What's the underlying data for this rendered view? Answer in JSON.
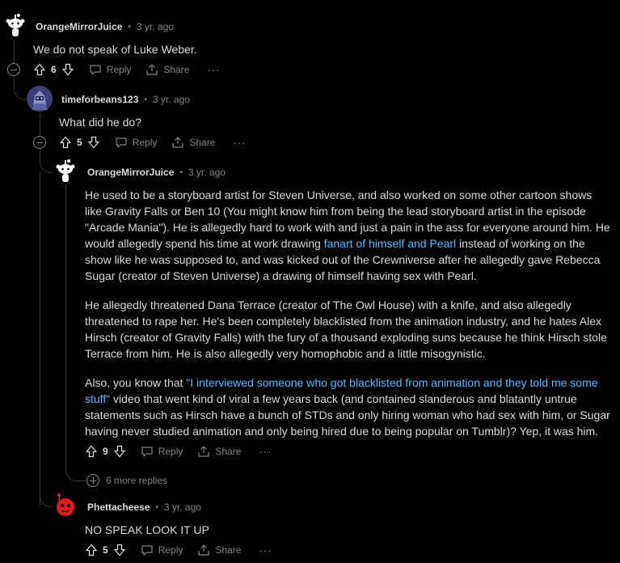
{
  "colors": {
    "background": "#000000",
    "text": "#d7dadc",
    "muted": "#818384",
    "link": "#4fbcff",
    "thread": "#343536"
  },
  "comments": [
    {
      "author": "OrangeMirrorJuice",
      "time": "3 yr. ago",
      "paragraphs": [
        [
          "We do not speak of Luke Weber."
        ]
      ],
      "score": "6",
      "reply_label": "Reply",
      "share_label": "Share",
      "more_label": "···"
    },
    {
      "author": "timeforbeans123",
      "time": "3 yr. ago",
      "paragraphs": [
        [
          "What did he do?"
        ]
      ],
      "score": "5",
      "reply_label": "Reply",
      "share_label": "Share",
      "more_label": "···"
    },
    {
      "author": "OrangeMirrorJuice",
      "time": "3 yr. ago",
      "paragraphs": [
        [
          "He used to be a storyboard artist for Steven Universe, and also worked on some other cartoon shows like Gravity Falls or Ben 10 (You might know him from being the lead storyboard artist in the episode \"Arcade Mania\"). He is allegedly hard to work with and just a pain in the ass for everyone around him. He would allegedly spend his time at work drawing ",
          "fanart of himself and Pearl",
          " instead of working on the show like he was supposed to, and was kicked out of the Crewniverse after he allegedly gave Rebecca Sugar (creator of Steven Universe) a drawing of himself having sex with Pearl."
        ],
        [
          "He allegedly threatened Dana Terrace (creator of The Owl House) with a knife, and also allegedly threatened to rape her. He's been completely blacklisted from the animation industry, and he hates Alex Hirsch (creator of Gravity Falls) with the fury of a thousand exploding suns because he think Hirsch stole Terrace from him. He is also allegedly very homophobic and a little misogynistic."
        ],
        [
          "Also, you know that ",
          "\"I interviewed someone who got blacklisted from animation and they told me some stuff\"",
          " video that went kind of viral a few years back (and contained slanderous and blatantly untrue statements such as Hirsch have a bunch of STDs and only hiring woman who had sex with him, or Sugar having never studied animation and only being hired due to being popular on Tumblr)? Yep, it was him."
        ]
      ],
      "score": "9",
      "reply_label": "Reply",
      "share_label": "Share",
      "more_label": "···"
    },
    {
      "author": "Phettacheese",
      "time": "3 yr. ago",
      "paragraphs": [
        [
          "NO SPEAK LOOK IT UP"
        ]
      ],
      "score": "5",
      "reply_label": "Reply",
      "share_label": "Share",
      "more_label": "···"
    }
  ],
  "more_replies_label": "6 more replies"
}
